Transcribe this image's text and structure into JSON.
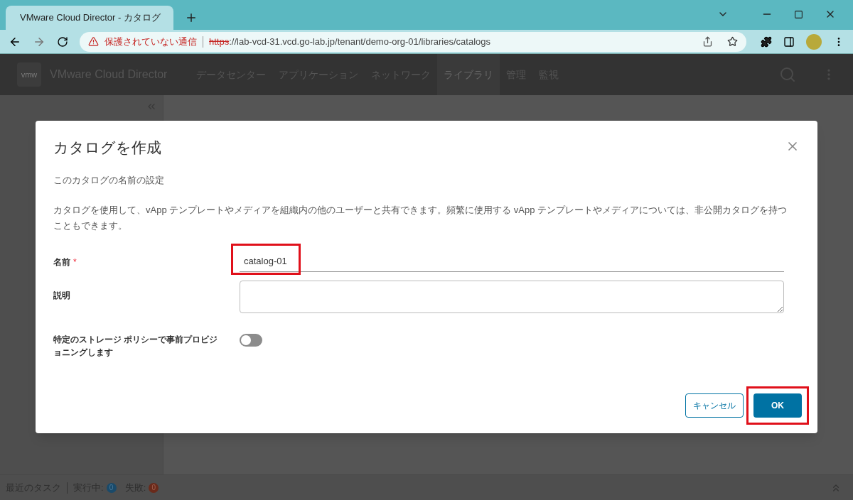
{
  "browser": {
    "tab_title": "VMware Cloud Director - カタログ",
    "security_label": "保護されていない通信",
    "url_scheme": "https",
    "url_rest": "://lab-vcd-31.vcd.go-lab.jp/tenant/demo-org-01/libraries/catalogs"
  },
  "app_header": {
    "logo": "vmw",
    "title": "VMware Cloud Director",
    "nav": [
      {
        "label": "データセンター",
        "selected": false
      },
      {
        "label": "アプリケーション",
        "selected": false
      },
      {
        "label": "ネットワーク",
        "selected": false
      },
      {
        "label": "ライブラリ",
        "selected": true
      },
      {
        "label": "管理",
        "selected": false
      },
      {
        "label": "監視",
        "selected": false
      }
    ]
  },
  "dialog": {
    "title": "カタログを作成",
    "subtitle": "このカタログの名前の設定",
    "description": "カタログを使用して、vApp テンプレートやメディアを組織内の他のユーザーと共有できます。頻繁に使用する vApp テンプレートやメディアについては、非公開カタログを持つこともできます。",
    "name_field": {
      "label": "名前",
      "required_mark": "*",
      "value": "catalog-01"
    },
    "description_field": {
      "label": "説明"
    },
    "storage_toggle": {
      "label": "特定のストレージ ポリシーで事前プロビジョニングします",
      "on": false
    },
    "buttons": [
      {
        "label": "キャンセル",
        "kind": "secondary"
      },
      {
        "label": "OK",
        "kind": "primary"
      }
    ]
  },
  "status_bar": {
    "recent_tasks": "最近のタスク",
    "running_label": "実行中:",
    "running_count": "0",
    "failed_label": "失敗:",
    "failed_count": "0"
  }
}
